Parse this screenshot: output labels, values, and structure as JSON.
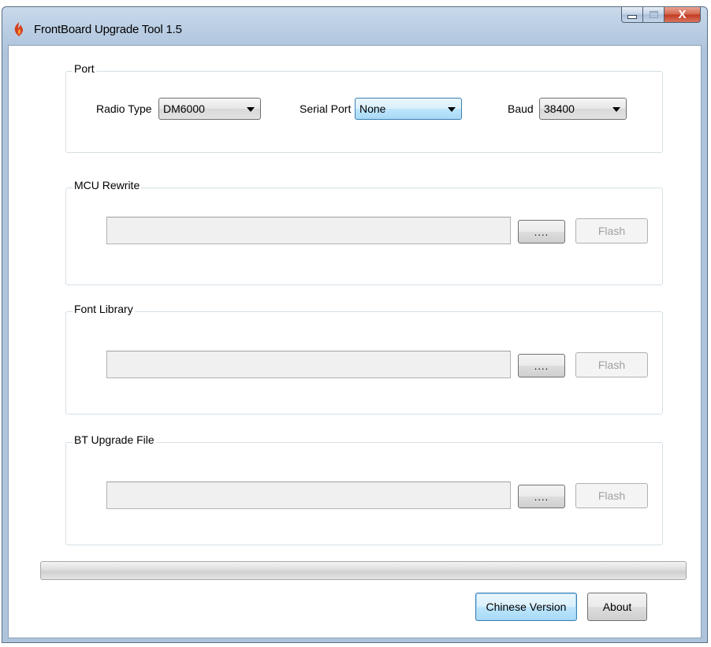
{
  "window": {
    "title": "FrontBoard Upgrade Tool 1.5",
    "close_label": "X"
  },
  "port_group": {
    "label": "Port",
    "radio_type": {
      "label": "Radio Type",
      "value": "DM6000"
    },
    "serial_port": {
      "label": "Serial Port",
      "value": "None"
    },
    "baud": {
      "label": "Baud",
      "value": "38400"
    }
  },
  "mcu_group": {
    "label": "MCU Rewrite",
    "path_value": "",
    "browse_label": "....",
    "flash_label": "Flash"
  },
  "font_group": {
    "label": "Font Library",
    "path_value": "",
    "browse_label": "....",
    "flash_label": "Flash"
  },
  "bt_group": {
    "label": "BT Upgrade File",
    "path_value": "",
    "browse_label": "....",
    "flash_label": "Flash"
  },
  "progress": {
    "value": 0
  },
  "footer": {
    "chinese_label": "Chinese Version",
    "about_label": "About"
  },
  "colors": {
    "focus_border": "#3c7fb1",
    "disabled_text": "#a0a0a0",
    "close_red": "#c1391f"
  }
}
